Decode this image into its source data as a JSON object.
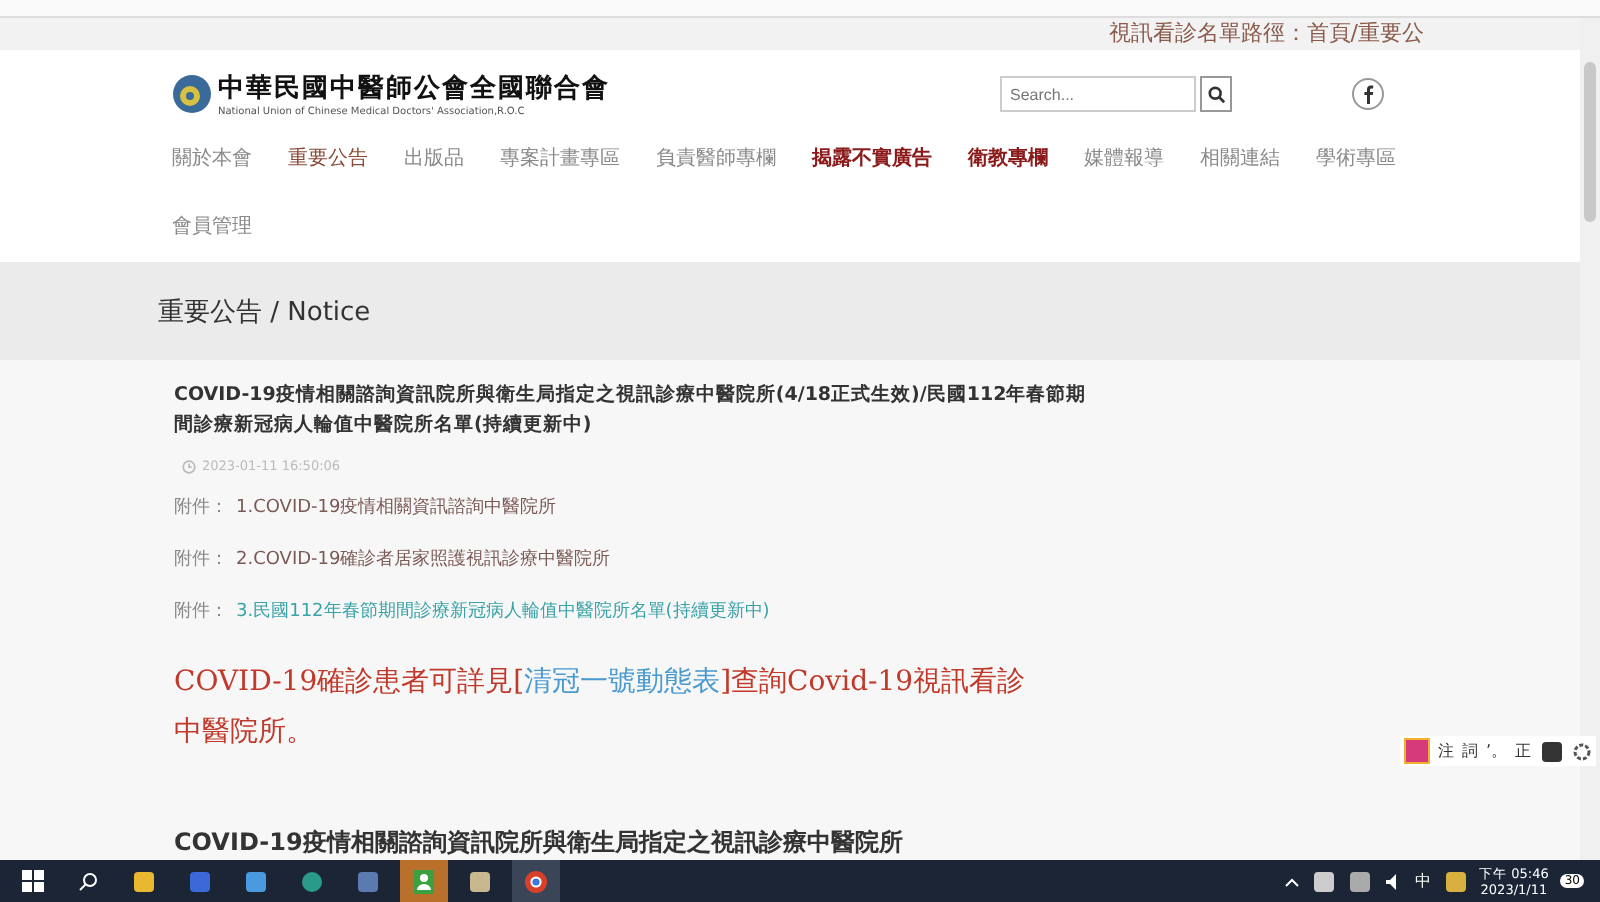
{
  "marquee": "視訊看診名單路徑：首頁/重要公",
  "header": {
    "logo_title": "中華民國中醫師公會全國聯合會",
    "logo_subtitle": "National Union of Chinese Medical Doctors' Association,R.O.C",
    "search": {
      "placeholder": "Search..."
    }
  },
  "nav": [
    {
      "label": "關於本會",
      "selected": false,
      "emphasis": false
    },
    {
      "label": "重要公告",
      "selected": true,
      "emphasis": false
    },
    {
      "label": "出版品",
      "selected": false,
      "emphasis": false
    },
    {
      "label": "專案計畫專區",
      "selected": false,
      "emphasis": false
    },
    {
      "label": "負責醫師專欄",
      "selected": false,
      "emphasis": false
    },
    {
      "label": "揭露不實廣告",
      "selected": false,
      "emphasis": true
    },
    {
      "label": "衛教專欄",
      "selected": false,
      "emphasis": true
    },
    {
      "label": "媒體報導",
      "selected": false,
      "emphasis": false
    },
    {
      "label": "相關連結",
      "selected": false,
      "emphasis": false
    },
    {
      "label": "學術專區",
      "selected": false,
      "emphasis": false
    },
    {
      "label": "會員管理",
      "selected": false,
      "emphasis": false
    }
  ],
  "page_title": "重要公告 / Notice",
  "post": {
    "title": "COVID-19疫情相關諮詢資訊院所與衛生局指定之視訊診療中醫院所(4/18正式生效)/民國112年春節期間診療新冠病人輪值中醫院所名單(持續更新中)",
    "date": "2023-01-11 16:50:06",
    "attachments": [
      {
        "prefix": "附件：",
        "link": "1.COVID-19疫情相關資訊諮詢中醫院所",
        "highlighted": false
      },
      {
        "prefix": "附件：",
        "link": "2.COVID-19確診者居家照護視訊診療中醫院所",
        "highlighted": false
      },
      {
        "prefix": "附件：",
        "link": "3.民國112年春節期間診療新冠病人輪值中醫院所名單(持續更新中)",
        "highlighted": true
      }
    ],
    "notice": {
      "before": "COVID-19確診患者可詳見[",
      "link": "清冠一號動態表",
      "after": "]查詢Covid-19視訊看診中醫院所。"
    }
  },
  "next_post_title": "COVID-19疫情相關諮詢資訊院所與衛生局指定之視訊診療中醫院所",
  "ime_toolbar": [
    "注",
    "詞",
    "’。",
    "正"
  ],
  "taskbar": {
    "input_language": "中",
    "time": "下午 05:46",
    "date": "2023/1/11",
    "notifications": "30"
  }
}
